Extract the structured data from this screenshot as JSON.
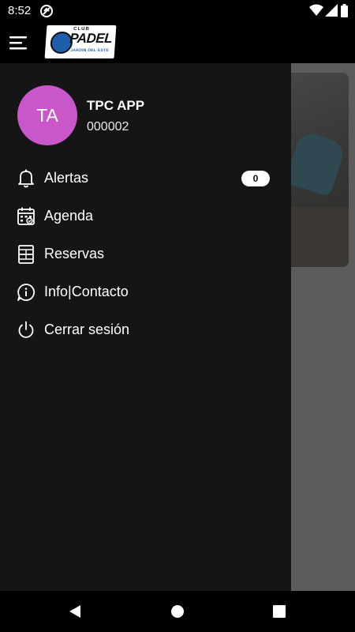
{
  "status_bar": {
    "time": "8:52",
    "icons": [
      "sync-icon",
      "wifi-icon",
      "signal-icon",
      "battery-icon"
    ]
  },
  "app_bar": {
    "menu_icon": "hamburger-icon",
    "logo": {
      "club": "CLUB",
      "name": "PADEL",
      "subtitle": "JARDIN DEL ESTE"
    }
  },
  "drawer": {
    "avatar_initials": "TA",
    "avatar_color": "#c957c9",
    "user_name": "TPC APP",
    "user_id": "000002",
    "items": [
      {
        "label": "Alertas",
        "icon": "bell-icon",
        "badge": "0"
      },
      {
        "label": "Agenda",
        "icon": "calendar-icon"
      },
      {
        "label": "Reservas",
        "icon": "court-icon"
      },
      {
        "label": "Info|Contacto",
        "icon": "info-chat-icon"
      },
      {
        "label": "Cerrar sesión",
        "icon": "power-icon"
      }
    ]
  },
  "nav_bar": {
    "buttons": [
      "back-icon",
      "home-icon",
      "recents-icon"
    ]
  }
}
